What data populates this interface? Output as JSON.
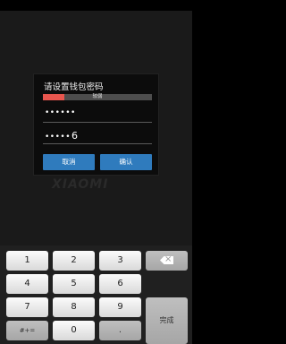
{
  "dialog": {
    "title": "请设置钱包密码",
    "strength": {
      "label": "较弱",
      "level": 0.2,
      "color": "#e8564e"
    },
    "password_1": "••••••",
    "password_2": "•••••",
    "password_2_last_char": "6",
    "cancel_label": "取消",
    "confirm_label": "确认",
    "button_color": "#2f7bbd"
  },
  "watermark": "XIAOMI",
  "keyboard": {
    "keys": {
      "k1": "1",
      "k2": "2",
      "k3": "3",
      "k4": "4",
      "k5": "5",
      "k6": "6",
      "k7": "7",
      "k8": "8",
      "k9": "9",
      "k0": "0",
      "symbols": "#+=",
      "period": ".",
      "done": "完成"
    },
    "backspace_icon": "backspace-icon"
  }
}
